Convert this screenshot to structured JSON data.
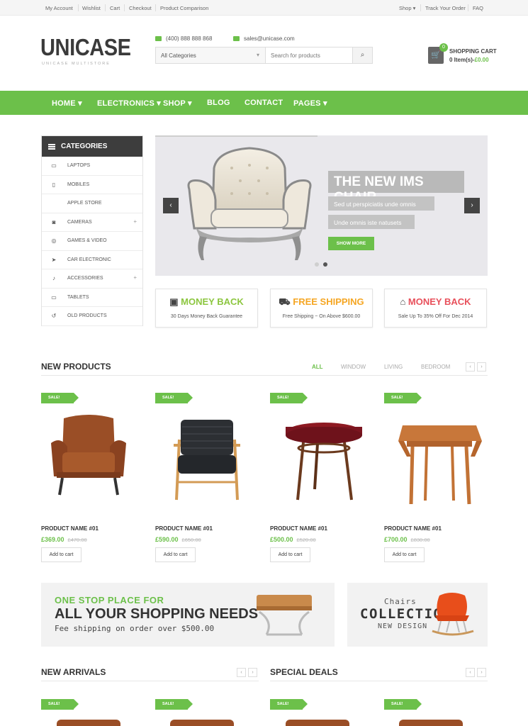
{
  "topbar": {
    "left_links": [
      "My Account",
      "Wishlist",
      "Cart",
      "Checkout",
      "Product Comparison"
    ],
    "shop": "Shop",
    "track": "Track Your Order",
    "faq": "FAQ"
  },
  "header": {
    "logo": "UNICASE",
    "logo_sub": "UNICASE MULTISTORE",
    "phone": "(400) 888 888 868",
    "email": "sales@unicase.com",
    "search_category": "All Categories",
    "search_placeholder": "Search for products",
    "cart_count": "0",
    "cart_title": "SHOPPING CART",
    "cart_items": "0 Item(s)-",
    "cart_total": "£0.00"
  },
  "nav": [
    "HOME",
    "ELECTRONICS",
    "SHOP",
    "BLOG",
    "CONTACT",
    "PAGES"
  ],
  "sidebar": {
    "title": "CATEGORIES",
    "items": [
      {
        "label": "LAPTOPS",
        "icon": "laptop-icon",
        "glyph": "▭"
      },
      {
        "label": "MOBILES",
        "icon": "mobile-icon",
        "glyph": "▯"
      },
      {
        "label": "APPLE STORE",
        "icon": "apple-icon",
        "glyph": ""
      },
      {
        "label": "CAMERAS",
        "icon": "camera-icon",
        "glyph": "◙",
        "expand": "+"
      },
      {
        "label": "GAMES & VIDEO",
        "icon": "gamepad-icon",
        "glyph": "◎"
      },
      {
        "label": "CAR ELECTRONIC",
        "icon": "location-arrow-icon",
        "glyph": "➤"
      },
      {
        "label": "ACCESSORIES",
        "icon": "microphone-icon",
        "glyph": "♪",
        "expand": "+"
      },
      {
        "label": "TABLETS",
        "icon": "tablet-icon",
        "glyph": "▭"
      },
      {
        "label": "OLD PRODUCTS",
        "icon": "history-icon",
        "glyph": "↺"
      }
    ]
  },
  "slider": {
    "title": "THE NEW IMS CHAIR",
    "line1": "Sed ut perspiciatis unde omnis",
    "line2": "Unde omnis iste natusets",
    "button": "SHOW MORE",
    "prev": "‹",
    "next": "›"
  },
  "info_boxes": [
    {
      "title": "MONEY BACK",
      "sub": "30 Days Money Back Guarantee",
      "color": "#8cc63f",
      "icon": "money-icon"
    },
    {
      "title": "FREE SHIPPING",
      "sub": "Free Shipping ~ On Above $600.00",
      "color": "#f5a623",
      "icon": "truck-icon"
    },
    {
      "title": "MONEY BACK",
      "sub": "Sale Up To 35% Off For Dec 2014",
      "color": "#e8505b",
      "icon": "gift-icon"
    }
  ],
  "new_products": {
    "title": "NEW PRODUCTS",
    "filters": [
      "ALL",
      "WINDOW",
      "LIVING",
      "BEDROOM"
    ],
    "items": [
      {
        "badge": "SALE!",
        "name": "PRODUCT NAME #01",
        "price": "£369.00",
        "old": "£470.00",
        "cart": "Add to cart"
      },
      {
        "badge": "SALE!",
        "name": "PRODUCT NAME #01",
        "price": "£590.00",
        "old": "£650.00",
        "cart": "Add to cart"
      },
      {
        "badge": "SALE!",
        "name": "PRODUCT NAME #01",
        "price": "£500.00",
        "old": "£520.00",
        "cart": "Add to cart"
      },
      {
        "badge": "SALE!",
        "name": "PRODUCT NAME #01",
        "price": "£700.00",
        "old": "£830.00",
        "cart": "Add to cart"
      }
    ]
  },
  "banner1": {
    "line1": "ONE STOP PLACE FOR",
    "line2": "ALL YOUR SHOPPING NEEDS",
    "line3": "Fee shipping on order over $500.00"
  },
  "banner2": {
    "line1": "Chairs",
    "line2": "COLLECTION",
    "line3": "NEW DESIGN"
  },
  "new_arrivals": {
    "title": "NEW ARRIVALS",
    "badges": [
      "SALE!",
      "SALE!"
    ]
  },
  "special_deals": {
    "title": "SPECIAL DEALS",
    "badges": [
      "SALE!",
      "SALE!"
    ]
  },
  "colors": {
    "accent": "#6cc04a",
    "dark": "#3d3d3d"
  }
}
